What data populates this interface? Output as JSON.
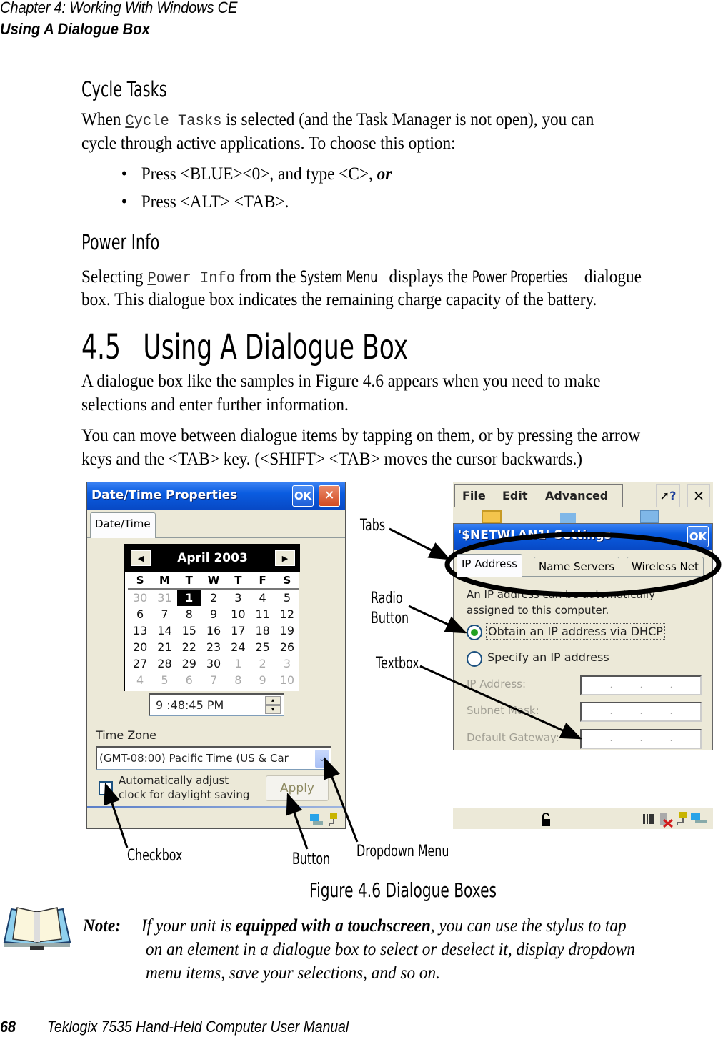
{
  "header": {
    "chapter": "Chapter  4:  Working With Windows CE",
    "section": "Using A Dialogue Box"
  },
  "cycle_tasks": {
    "heading": "Cycle Tasks",
    "p1_pre": "When ",
    "p1_cmd_first": "C",
    "p1_cmd_rest": "ycle Tasks",
    "p1_post": " is selected (and the Task Manager is not open), you can",
    "p1_line2": "cycle through active applications. To choose this option:",
    "bullets": [
      {
        "text": "Press <BLUE><0>, and type <C>, ",
        "emphasis": "or"
      },
      {
        "text": "Press <ALT> <TAB>.",
        "emphasis": ""
      }
    ],
    "bullet_glyph": "•"
  },
  "power_info": {
    "heading": "Power Info",
    "p_pre": "Selecting ",
    "cmd_first": "P",
    "cmd_rest": "ower Info",
    "p_mid1": " from the ",
    "em1": "System Menu",
    "p_mid2": " displays the ",
    "em2": "Power Properties",
    "p_post": " dialogue",
    "line2": "box. This dialogue box indicates the remaining charge capacity of the battery."
  },
  "section_4_5": {
    "number": "4.5",
    "title": "Using A Dialogue Box",
    "p1_line1": "A dialogue box like the samples in Figure 4.6 appears when you need to make",
    "p1_line2": "selections and enter further information.",
    "p2_line1": "You can move between dialogue items by tapping on them, or by pressing the arrow",
    "p2_line2": "keys and the <TAB> key. (<SHIFT> <TAB> moves the cursor backwards.)"
  },
  "figure": {
    "caption": "Figure 4.6 Dialogue Boxes",
    "callouts": {
      "tabs": "Tabs",
      "radio_line1": "Radio",
      "radio_line2": "Button",
      "textbox": "Textbox",
      "checkbox": "Checkbox",
      "button": "Button",
      "dropdown": "Dropdown  Menu"
    },
    "datetime_dialog": {
      "title": "Date/Time Properties",
      "ok": "OK",
      "close": "✕",
      "tab": "Date/Time",
      "calendar": {
        "month_label": "April 2003",
        "prev": "◀",
        "next": "▶",
        "weekdays": [
          "S",
          "M",
          "T",
          "W",
          "T",
          "F",
          "S"
        ],
        "days": [
          {
            "d": "30",
            "dim": true
          },
          {
            "d": "31",
            "dim": true
          },
          {
            "d": "1",
            "sel": true
          },
          {
            "d": "2"
          },
          {
            "d": "3"
          },
          {
            "d": "4"
          },
          {
            "d": "5"
          },
          {
            "d": "6"
          },
          {
            "d": "7"
          },
          {
            "d": "8"
          },
          {
            "d": "9"
          },
          {
            "d": "10"
          },
          {
            "d": "11"
          },
          {
            "d": "12"
          },
          {
            "d": "13"
          },
          {
            "d": "14"
          },
          {
            "d": "15"
          },
          {
            "d": "16"
          },
          {
            "d": "17"
          },
          {
            "d": "18"
          },
          {
            "d": "19"
          },
          {
            "d": "20"
          },
          {
            "d": "21"
          },
          {
            "d": "22"
          },
          {
            "d": "23"
          },
          {
            "d": "24"
          },
          {
            "d": "25"
          },
          {
            "d": "26"
          },
          {
            "d": "27"
          },
          {
            "d": "28"
          },
          {
            "d": "29"
          },
          {
            "d": "30"
          },
          {
            "d": "1",
            "dim": true
          },
          {
            "d": "2",
            "dim": true
          },
          {
            "d": "3",
            "dim": true
          },
          {
            "d": "4",
            "dim": true
          },
          {
            "d": "5",
            "dim": true
          },
          {
            "d": "6",
            "dim": true
          },
          {
            "d": "7",
            "dim": true
          },
          {
            "d": "8",
            "dim": true
          },
          {
            "d": "9",
            "dim": true
          },
          {
            "d": "10",
            "dim": true
          }
        ]
      },
      "time_value": "9 :48:45 PM",
      "time_zone_label": "Time Zone",
      "time_zone_value": "(GMT-08:00) Pacific Time (US & Car",
      "dropdown_arrow": "⌄",
      "dst_checkbox_line1": "Automatically adjust",
      "dst_checkbox_line2": "clock for daylight saving",
      "dst_checked": false,
      "apply": "Apply"
    },
    "netwlan_dialog": {
      "menu": [
        "File",
        "Edit",
        "Advanced"
      ],
      "help": "?",
      "close": "×",
      "title": "'$NETWLAN1' Settings",
      "ok": "OK",
      "tabs": [
        "IP Address",
        "Name Servers",
        "Wireless Net"
      ],
      "desc_line1": "An IP address can be automatically",
      "desc_line2": "assigned to this computer.",
      "radio_dhcp": "Obtain an IP address via DHCP",
      "radio_specify": "Specify an IP address",
      "selected_radio": "dhcp",
      "fields": [
        {
          "label": "IP Address:",
          "value": ". . ."
        },
        {
          "label": "Subnet Mask:",
          "value": ". . ."
        },
        {
          "label": "Default Gateway:",
          "value": ". . ."
        }
      ]
    }
  },
  "note": {
    "label": "Note:",
    "l1_pre": "If your unit is ",
    "l1_bold": "equipped with a touchscreen",
    "l1_post": ", you can use the stylus to tap",
    "l2": "on an element in a dialogue box to select or deselect it, display dropdown",
    "l3": "menu items, save your selections, and so on."
  },
  "footer": {
    "page": "68",
    "title": "Teklogix 7535 Hand-Held Computer User Manual"
  }
}
